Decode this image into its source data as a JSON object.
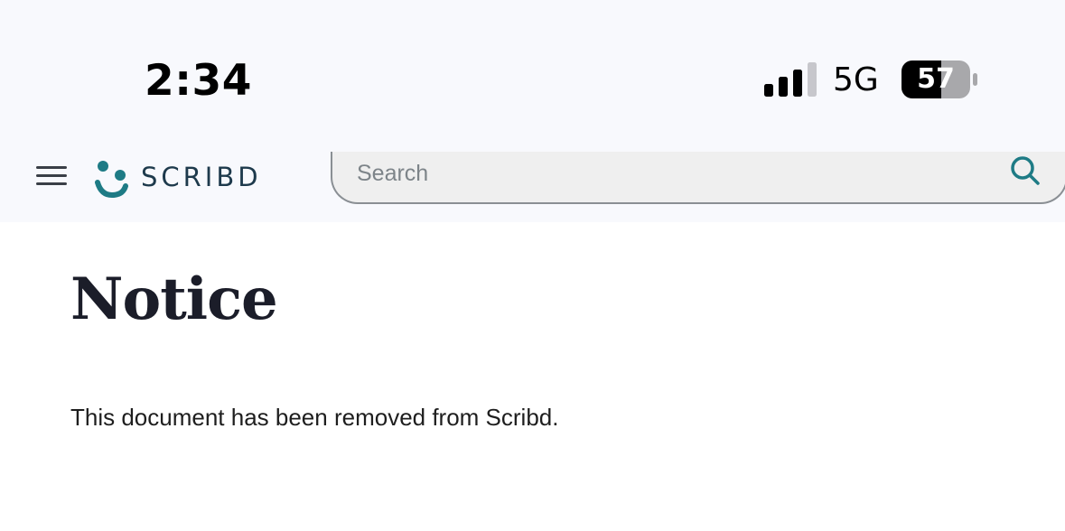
{
  "status_bar": {
    "time": "2:34",
    "network": "5G",
    "battery": "57",
    "signal_bars": 3,
    "icons": [
      "signal-icon",
      "battery-icon"
    ]
  },
  "header": {
    "menu_icon": "hamburger-menu-icon",
    "logo_text": "SCRIBD",
    "search": {
      "placeholder": "Search",
      "value": ""
    },
    "search_icon": "search-icon",
    "accent_color": "#1e7b85"
  },
  "main": {
    "title": "Notice",
    "message": "This document has been removed from Scribd."
  }
}
